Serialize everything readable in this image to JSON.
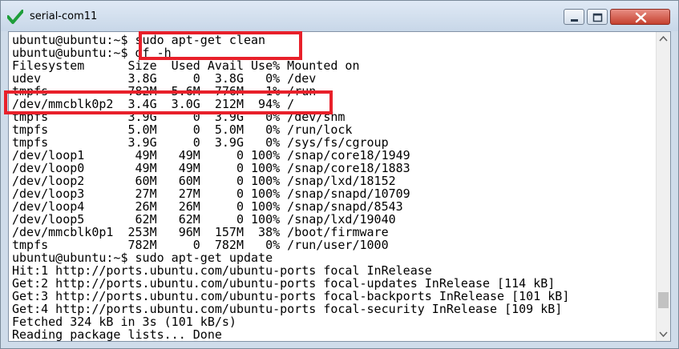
{
  "window": {
    "title": "serial-com11",
    "accent": "#1e9e3a",
    "highlight_color": "#e8202a",
    "icons": [
      "checkmark-icon",
      "minimize-icon",
      "maximize-icon",
      "close-icon"
    ]
  },
  "terminal": {
    "lines": [
      "ubuntu@ubuntu:~$ sudo apt-get clean",
      "ubuntu@ubuntu:~$ df -h",
      "Filesystem      Size  Used Avail Use% Mounted on",
      "udev            3.8G     0  3.8G   0% /dev",
      "tmpfs           782M  5.6M  776M   1% /run",
      "/dev/mmcblk0p2  3.4G  3.0G  212M  94% /",
      "tmpfs           3.9G     0  3.9G   0% /dev/shm",
      "tmpfs           5.0M     0  5.0M   0% /run/lock",
      "tmpfs           3.9G     0  3.9G   0% /sys/fs/cgroup",
      "/dev/loop1       49M   49M     0 100% /snap/core18/1949",
      "/dev/loop0       49M   49M     0 100% /snap/core18/1883",
      "/dev/loop2       60M   60M     0 100% /snap/lxd/18152",
      "/dev/loop3       27M   27M     0 100% /snap/snapd/10709",
      "/dev/loop4       26M   26M     0 100% /snap/snapd/8543",
      "/dev/loop5       62M   62M     0 100% /snap/lxd/19040",
      "/dev/mmcblk0p1  253M   96M  157M  38% /boot/firmware",
      "tmpfs           782M     0  782M   0% /run/user/1000",
      "ubuntu@ubuntu:~$ sudo apt-get update",
      "Hit:1 http://ports.ubuntu.com/ubuntu-ports focal InRelease",
      "Get:2 http://ports.ubuntu.com/ubuntu-ports focal-updates InRelease [114 kB]",
      "Get:3 http://ports.ubuntu.com/ubuntu-ports focal-backports InRelease [101 kB]",
      "Get:4 http://ports.ubuntu.com/ubuntu-ports focal-security InRelease [109 kB]",
      "Fetched 324 kB in 3s (101 kB/s)",
      "Reading package lists... Done"
    ]
  }
}
